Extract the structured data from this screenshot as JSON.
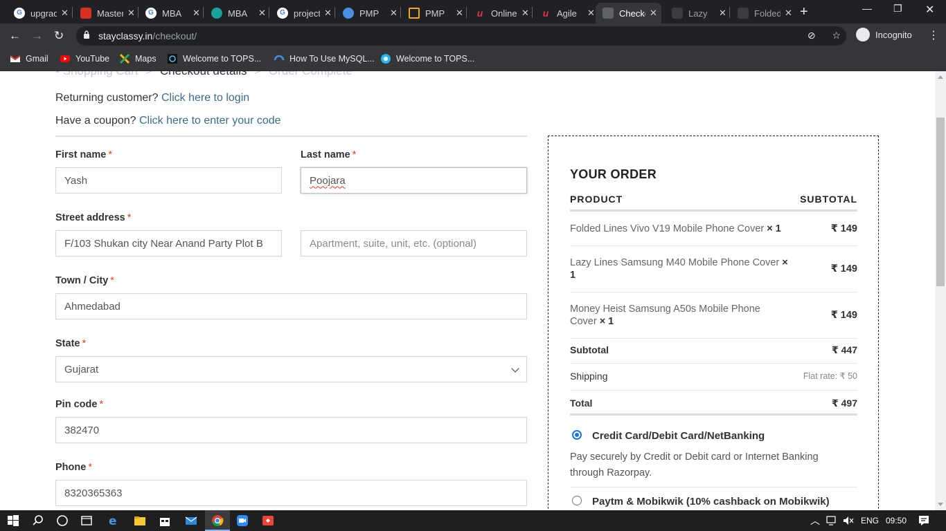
{
  "browser": {
    "tabs": [
      {
        "title": "upgrad",
        "icon": "google-icon",
        "color": "#4285f4"
      },
      {
        "title": "Masters",
        "icon": "shield-icon",
        "color": "#d93025"
      },
      {
        "title": "MBA",
        "icon": "google-icon",
        "color": "#4285f4"
      },
      {
        "title": "MBA",
        "icon": "map-pin-icon",
        "color": "#1aa39a"
      },
      {
        "title": "project",
        "icon": "google-icon",
        "color": "#4285f4"
      },
      {
        "title": "PMP",
        "icon": "pmp-icon",
        "color": "#4a90e2"
      },
      {
        "title": "PMP",
        "icon": "chart-icon",
        "color": "#f5a623"
      },
      {
        "title": "Online",
        "icon": "udemy-icon",
        "color": "#e0334d"
      },
      {
        "title": "Agile",
        "icon": "udemy-icon",
        "color": "#e0334d"
      },
      {
        "title": "Checkout",
        "icon": "stayclassy-icon",
        "color": "#777777"
      },
      {
        "title": "Lazy",
        "icon": "stayclassy-icon",
        "color": "#777777"
      },
      {
        "title": "Folded",
        "icon": "stayclassy-icon",
        "color": "#777777"
      }
    ],
    "active_tab_index": 9,
    "url_host": "stayclassy.in",
    "url_path": "/checkout/",
    "incognito_label": "Incognito",
    "bookmarks": [
      {
        "label": "Gmail",
        "icon": "gmail-icon"
      },
      {
        "label": "YouTube",
        "icon": "youtube-icon"
      },
      {
        "label": "Maps",
        "icon": "maps-icon"
      },
      {
        "label": "Welcome to TOPS...",
        "icon": "tops-icon"
      },
      {
        "label": "How To Use MySQL...",
        "icon": "mysql-icon"
      },
      {
        "label": "Welcome to TOPS...",
        "icon": "tops-gear-icon"
      }
    ]
  },
  "breadcrumb": {
    "step1": "Shopping Cart",
    "sep": ">",
    "step2": "Checkout details",
    "step3": "Order Complete"
  },
  "notices": {
    "returning_text": "Returning customer?",
    "returning_link": "Click here to login",
    "coupon_text": "Have a coupon?",
    "coupon_link": "Click here to enter your code"
  },
  "form": {
    "required_mark": "*",
    "first_name_label": "First name",
    "first_name_value": "Yash",
    "last_name_label": "Last name",
    "last_name_value": "Poojara",
    "street_label": "Street address",
    "street_value": "F/103 Shukan city Near Anand Party Plot B",
    "apartment_placeholder": "Apartment, suite, unit, etc. (optional)",
    "city_label": "Town / City",
    "city_value": "Ahmedabad",
    "state_label": "State",
    "state_value": "Gujarat",
    "pin_label": "Pin code",
    "pin_value": "382470",
    "phone_label": "Phone",
    "phone_value": "8320365363"
  },
  "order": {
    "title": "YOUR ORDER",
    "col_product": "PRODUCT",
    "col_subtotal": "SUBTOTAL",
    "items": [
      {
        "name": "Folded Lines Vivo V19 Mobile Phone Cover",
        "qty": "× 1",
        "price": "₹ 149"
      },
      {
        "name": "Lazy Lines Samsung M40 Mobile Phone Cover",
        "qty": "× 1",
        "price": "₹ 149"
      },
      {
        "name": "Money Heist Samsung A50s Mobile Phone Cover",
        "qty": "× 1",
        "price": "₹ 149"
      }
    ],
    "subtotal_label": "Subtotal",
    "subtotal_value": "₹ 447",
    "shipping_label": "Shipping",
    "shipping_value": "Flat rate: ₹ 50",
    "total_label": "Total",
    "total_value": "₹ 497",
    "payment_options": [
      {
        "label": "Credit Card/Debit Card/NetBanking",
        "selected": true
      },
      {
        "label": "Paytm & Mobikwik (10% cashback on Mobikwik)",
        "selected": false
      }
    ],
    "payment_desc": "Pay securely by Credit or Debit card or Internet Banking through Razorpay."
  },
  "taskbar": {
    "language": "ENG",
    "time": "09:50"
  },
  "colors": {
    "link": "#3a6b8c",
    "required": "#e2401c",
    "chrome_dark": "#202124",
    "chrome_toolbar": "#35363a",
    "radio_selected": "#1a73e8"
  }
}
